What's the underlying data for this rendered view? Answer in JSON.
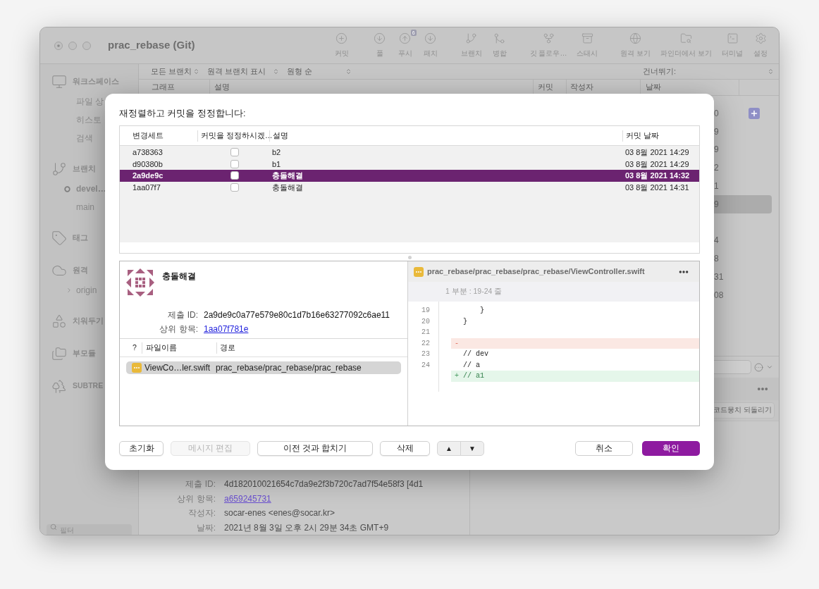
{
  "window": {
    "title": "prac_rebase (Git)"
  },
  "toolbar": {
    "groups": [
      [
        {
          "label": "커밋"
        }
      ],
      [
        {
          "label": "풀"
        },
        {
          "label": "푸시",
          "badge": "6"
        },
        {
          "label": "패치"
        }
      ],
      [
        {
          "label": "브랜치"
        },
        {
          "label": "병합"
        }
      ],
      [
        {
          "label": "깃 플로우…"
        },
        {
          "label": "스태시"
        }
      ],
      [
        {
          "label": "원격 보기"
        },
        {
          "label": "파인더에서 보기"
        },
        {
          "label": "터미널"
        },
        {
          "label": "설정"
        }
      ]
    ]
  },
  "sidebar": {
    "sections": [
      {
        "label": "워크스페이스",
        "children": [
          {
            "label": "파일 상"
          },
          {
            "label": "히스토"
          },
          {
            "label": "검색"
          }
        ]
      },
      {
        "label": "브랜치",
        "children": [
          {
            "label": "devel…",
            "current": true
          },
          {
            "label": "main",
            "current": false
          }
        ]
      },
      {
        "label": "태그"
      },
      {
        "label": "원격",
        "children": [
          {
            "label": "origin",
            "expanded": false
          }
        ]
      },
      {
        "label": "치워두기"
      },
      {
        "label": "부모듈"
      },
      {
        "label": "SUBTRE"
      }
    ],
    "filter": {
      "placeholder": "필터"
    }
  },
  "filter_bar": {
    "dropdowns": [
      {
        "label": "모든 브랜치"
      },
      {
        "label": "원격 브랜치 표시"
      },
      {
        "label": "원형 순"
      }
    ],
    "jump": {
      "label": "건너뛰기:"
    }
  },
  "commit_list": {
    "columns": [
      "그래프",
      "설명",
      "커밋",
      "작성자",
      "날짜"
    ],
    "rows": [
      {
        "column_1": "0",
        "selected": false
      },
      {
        "column_1": "9",
        "selected": false
      },
      {
        "column_1": "9",
        "selected": false
      },
      {
        "column_1": "2",
        "selected": false
      },
      {
        "column_1": "1",
        "selected": false
      },
      {
        "column_1": "9",
        "selected": true
      },
      {
        "selected": false
      },
      {
        "column_1": "4",
        "selected": false
      },
      {
        "column_1": "8",
        "selected": false
      },
      {
        "column_1": "31",
        "selected": false
      },
      {
        "column_1": "08",
        "selected": false
      }
    ]
  },
  "details": {
    "rows": [
      {
        "label": "제출 ID:",
        "value": "4d182010021654c7da9e2f3b720c7ad7f54e58f3 [4d1",
        "kind": "text"
      },
      {
        "label": "상위 항목:",
        "value": "a659245731",
        "kind": "link"
      },
      {
        "label": "작성자:",
        "value": "socar-enes <enes@socar.kr>",
        "kind": "text"
      },
      {
        "label": "날짜:",
        "value": "2021년 8월 3일 오후 2시 29분 34초 GMT+9",
        "kind": "text"
      }
    ]
  },
  "hunk_panel": {
    "revert_button": {
      "label": "코드뭉치 되돌리기"
    }
  },
  "dialog": {
    "title": "재정렬하고 커밋을 정정합니다:",
    "table": {
      "columns": [
        "변경세트",
        "커밋을 정정하시겠…",
        "설명",
        "커밋 날짜"
      ],
      "rows": [
        {
          "changeset": "a738363",
          "amend": false,
          "description": "b2",
          "date": "03 8월 2021 14:29",
          "selected": false
        },
        {
          "changeset": "d90380b",
          "amend": false,
          "description": "b1",
          "date": "03 8월 2021 14:29",
          "selected": false
        },
        {
          "changeset": "2a9de9c",
          "amend": false,
          "description": "충돌해결",
          "date": "03 8월 2021 14:32",
          "selected": true
        },
        {
          "changeset": "1aa07f7",
          "amend": false,
          "description": "충돌해결",
          "date": "03 8월 2021 14:31",
          "selected": false
        }
      ]
    },
    "commit": {
      "title": "충돌해결",
      "meta": [
        {
          "label": "제출 ID:",
          "value": "2a9de9c0a77e579e80c1d7b16e63277092c6ae11",
          "kind": "text"
        },
        {
          "label": "상위 항목:",
          "value": "1aa07f781e",
          "kind": "link"
        }
      ],
      "files": {
        "columns": [
          "?",
          "파일이름",
          "경로"
        ],
        "rows": [
          {
            "name": "ViewCo…ler.swift",
            "path": "prac_rebase/prac_rebase/prac_rebase",
            "selected": true
          }
        ]
      }
    },
    "diff": {
      "file": "prac_rebase/prac_rebase/prac_rebase/ViewController.swift",
      "hunk": "1 부분 : 19-24 줄",
      "lines": [
        {
          "number": "19",
          "kind": "context",
          "text": "    }"
        },
        {
          "number": "20",
          "kind": "context",
          "text": "}"
        },
        {
          "number": "21",
          "kind": "context"
        },
        {
          "number": "22",
          "kind": "removed",
          "sign": "-"
        },
        {
          "number": "23",
          "kind": "context",
          "text": "// dev"
        },
        {
          "number": "24",
          "kind": "context",
          "text": "// a"
        },
        {
          "kind": "added",
          "sign": "+",
          "text": "// a1"
        }
      ]
    },
    "buttons": [
      {
        "label": "초기화",
        "disabled": false
      },
      {
        "label": "메시지 편집",
        "disabled": true
      },
      {
        "label": "이전 것과 합치기",
        "disabled": false
      },
      {
        "label": "삭제",
        "disabled": false
      }
    ],
    "move": {
      "up": "▲",
      "down": "▼"
    },
    "actions": [
      {
        "label": "취소",
        "primary": false
      },
      {
        "label": "확인",
        "primary": true
      }
    ]
  }
}
